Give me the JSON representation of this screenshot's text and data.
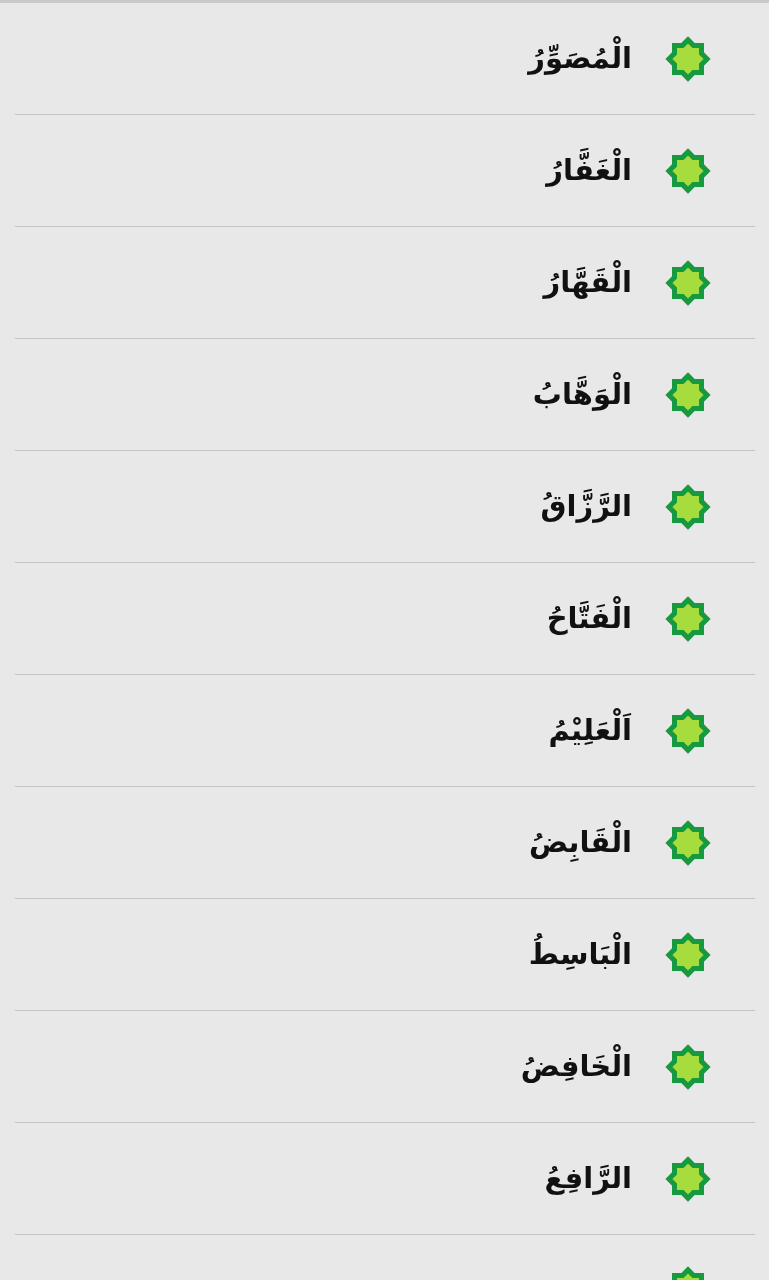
{
  "names": [
    {
      "name": "الْمُصَوِّرُ"
    },
    {
      "name": "الْغَفَّارُ"
    },
    {
      "name": "الْقَهَّارُ"
    },
    {
      "name": "الْوَهَّابُ"
    },
    {
      "name": "الرَّزَّاقُ"
    },
    {
      "name": "الْفَتَّاحُ"
    },
    {
      "name": "اَلْعَلِيْمُ"
    },
    {
      "name": "الْقَابِضُ"
    },
    {
      "name": "الْبَاسِطُ"
    },
    {
      "name": "الْخَافِضُ"
    },
    {
      "name": "الرَّافِعُ"
    },
    {
      "kind": "cut"
    }
  ]
}
